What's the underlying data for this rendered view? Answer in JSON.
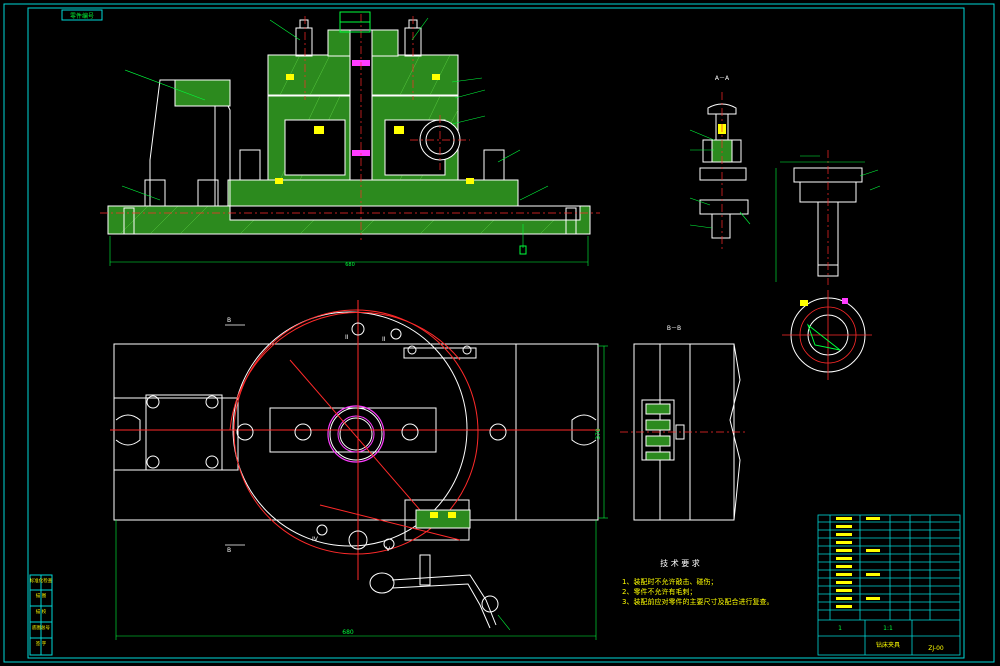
{
  "drawing": {
    "corner_tag": "零件编号",
    "section_aa": "A－A",
    "section_bb": "B－B",
    "view_b_top": "B",
    "view_b_bottom": "B",
    "dim_bottom": "680",
    "dim_right": "370",
    "tech_title": "技 术 要 求",
    "tech_notes": [
      "1、装配时不允许敲击、碰伤；",
      "2、零件不允许有毛刺；",
      "3、装配前应对零件的主要尺寸及配合进行复查。"
    ],
    "roman_marks": [
      "I",
      "II",
      "III",
      "IV",
      "V"
    ],
    "colors": {
      "background": "#000000",
      "frame": "#00d8d8",
      "outline": "#ffffff",
      "center": "#ff2a2a",
      "leader": "#00ff3c",
      "section_fill": "#2c8a1e",
      "accent": "#ff3cff",
      "yellow": "#ffff00"
    }
  },
  "title_block": {
    "name": "钻床夹具",
    "drawing_no": "ZJ-00",
    "scale": "1:1",
    "sheet": "1"
  },
  "side_labels": [
    "标准化检查",
    "描 图",
    "描 校",
    "底图总号",
    "签 字"
  ]
}
